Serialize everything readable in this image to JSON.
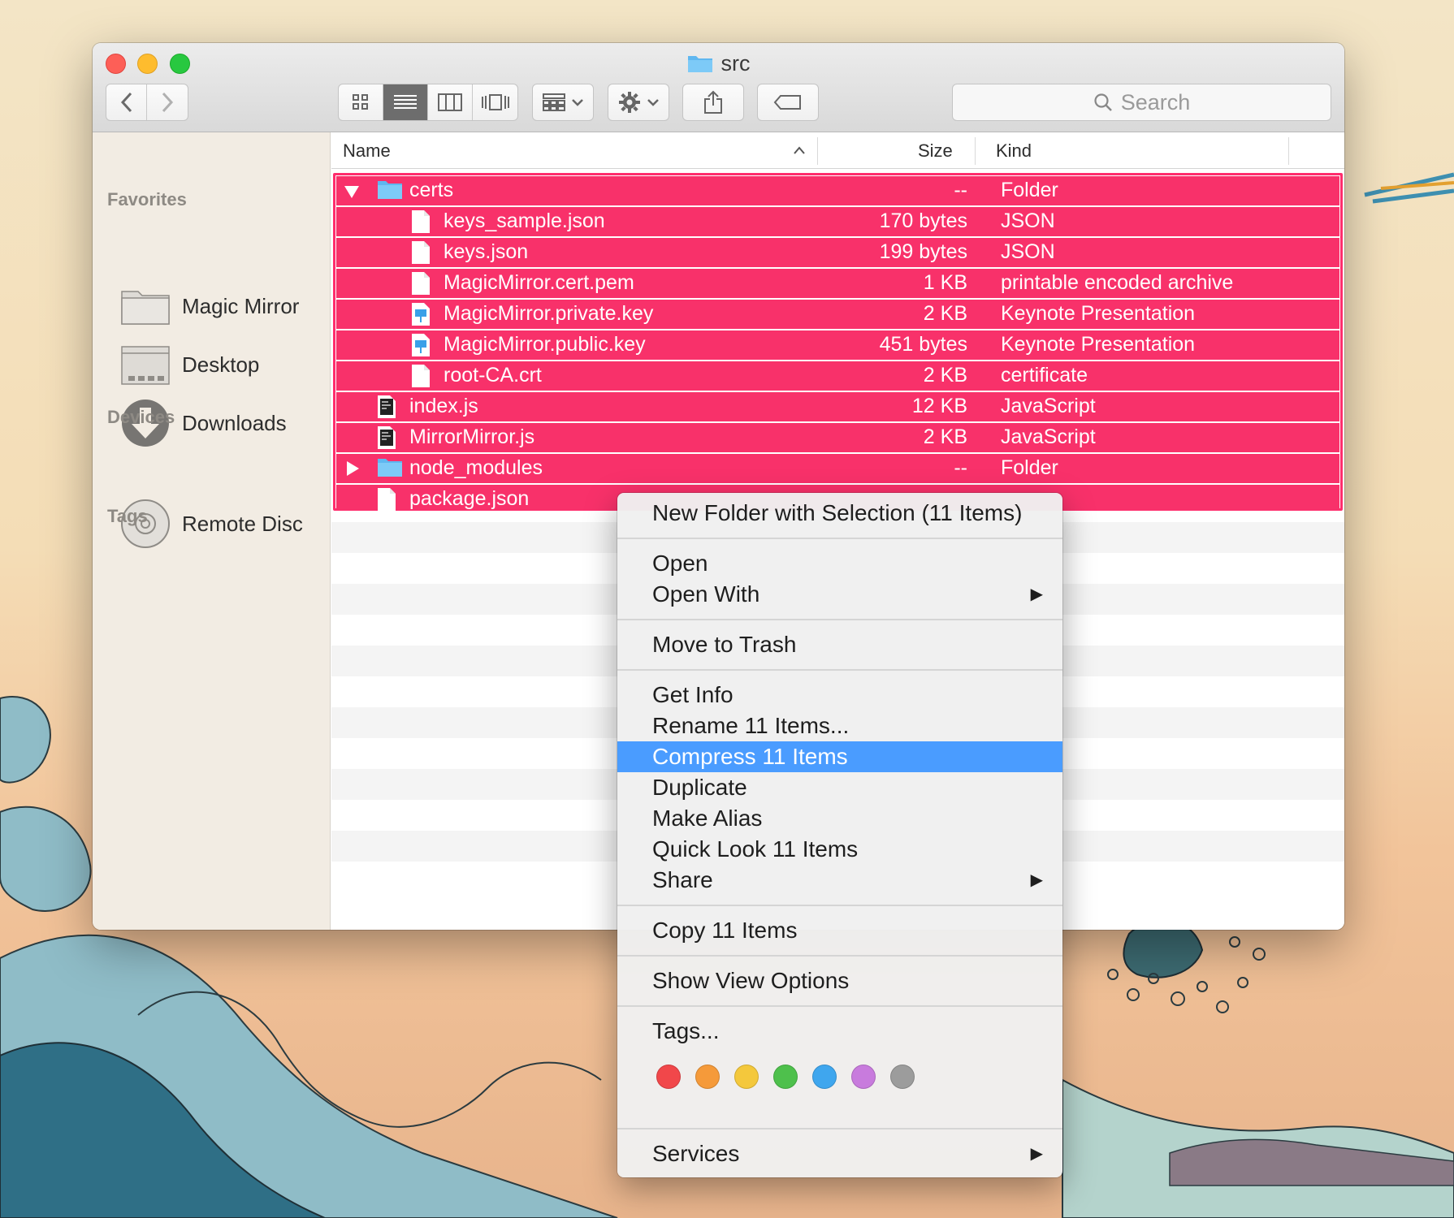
{
  "window": {
    "title": "src",
    "search_placeholder": "Search"
  },
  "sidebar": {
    "favorites_heading": "Favorites",
    "favorites": [
      "Magic Mirror",
      "Desktop",
      "Downloads"
    ],
    "devices_heading": "Devices",
    "devices": [
      "Remote Disc"
    ],
    "tags_heading": "Tags"
  },
  "columns": {
    "name": "Name",
    "size": "Size",
    "kind": "Kind"
  },
  "files": [
    {
      "name": "certs",
      "size": "--",
      "kind": "Folder",
      "type": "folder-open",
      "indent": 0
    },
    {
      "name": "keys_sample.json",
      "size": "170 bytes",
      "kind": "JSON",
      "type": "doc",
      "indent": 1
    },
    {
      "name": "keys.json",
      "size": "199 bytes",
      "kind": "JSON",
      "type": "doc",
      "indent": 1
    },
    {
      "name": "MagicMirror.cert.pem",
      "size": "1 KB",
      "kind": "printable encoded archive",
      "type": "doc",
      "indent": 1
    },
    {
      "name": "MagicMirror.private.key",
      "size": "2 KB",
      "kind": "Keynote Presentation",
      "type": "keynote",
      "indent": 1
    },
    {
      "name": "MagicMirror.public.key",
      "size": "451 bytes",
      "kind": "Keynote Presentation",
      "type": "keynote",
      "indent": 1
    },
    {
      "name": "root-CA.crt",
      "size": "2 KB",
      "kind": "certificate",
      "type": "doc",
      "indent": 1
    },
    {
      "name": "index.js",
      "size": "12 KB",
      "kind": "JavaScript",
      "type": "script",
      "indent": 0
    },
    {
      "name": "MirrorMirror.js",
      "size": "2 KB",
      "kind": "JavaScript",
      "type": "script",
      "indent": 0
    },
    {
      "name": "node_modules",
      "size": "--",
      "kind": "Folder",
      "type": "folder-closed",
      "indent": 0
    },
    {
      "name": "package.json",
      "size": "",
      "kind": "",
      "type": "doc",
      "indent": 0
    }
  ],
  "context_menu": {
    "new_folder": "New Folder with Selection (11 Items)",
    "open": "Open",
    "open_with": "Open With",
    "move_to_trash": "Move to Trash",
    "get_info": "Get Info",
    "rename": "Rename 11 Items...",
    "compress": "Compress 11 Items",
    "duplicate": "Duplicate",
    "make_alias": "Make Alias",
    "quick_look": "Quick Look 11 Items",
    "share": "Share",
    "copy": "Copy 11 Items",
    "show_view_options": "Show View Options",
    "tags": "Tags...",
    "services": "Services",
    "tag_colors": [
      "#f1474a",
      "#f59a3a",
      "#f4c83c",
      "#4ec04c",
      "#3fa6ee",
      "#c87bdd",
      "#9c9c9c"
    ]
  }
}
